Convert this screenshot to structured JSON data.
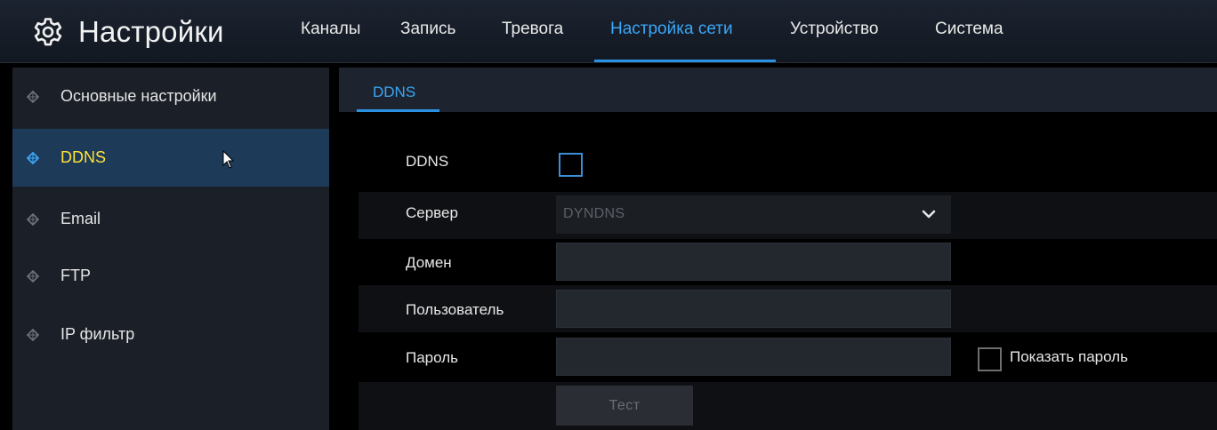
{
  "header": {
    "title": "Настройки",
    "tabs": [
      {
        "label": "Каналы"
      },
      {
        "label": "Запись"
      },
      {
        "label": "Тревога"
      },
      {
        "label": "Настройка сети"
      },
      {
        "label": "Устройство"
      },
      {
        "label": "Система"
      }
    ],
    "active_tab": "Настройка сети"
  },
  "sidebar": {
    "items": [
      {
        "label": "Основные настройки"
      },
      {
        "label": "DDNS"
      },
      {
        "label": "Email"
      },
      {
        "label": "FTP"
      },
      {
        "label": "IP фильтр"
      }
    ],
    "active_item": "DDNS"
  },
  "subtabs": {
    "items": [
      {
        "label": "DDNS"
      }
    ]
  },
  "form": {
    "ddns_label": "DDNS",
    "ddns_enabled": false,
    "server_label": "Сервер",
    "server_value": "DYNDNS",
    "domain_label": "Домен",
    "domain_value": "",
    "user_label": "Пользователь",
    "user_value": "",
    "password_label": "Пароль",
    "password_value": "",
    "show_password_label": "Показать пароль",
    "show_password_checked": false,
    "test_button": "Тест"
  },
  "colors": {
    "accent": "#3aa6f5",
    "active_sidebar_text": "#ffe23a",
    "active_sidebar_bg": "#1d3a58",
    "background": "#000000"
  },
  "icons": {
    "brand": "gear-icon",
    "sidebar_bullet": "diamond-icon",
    "select_arrow": "chevron-down-icon",
    "pointer": "mouse-cursor-icon"
  }
}
